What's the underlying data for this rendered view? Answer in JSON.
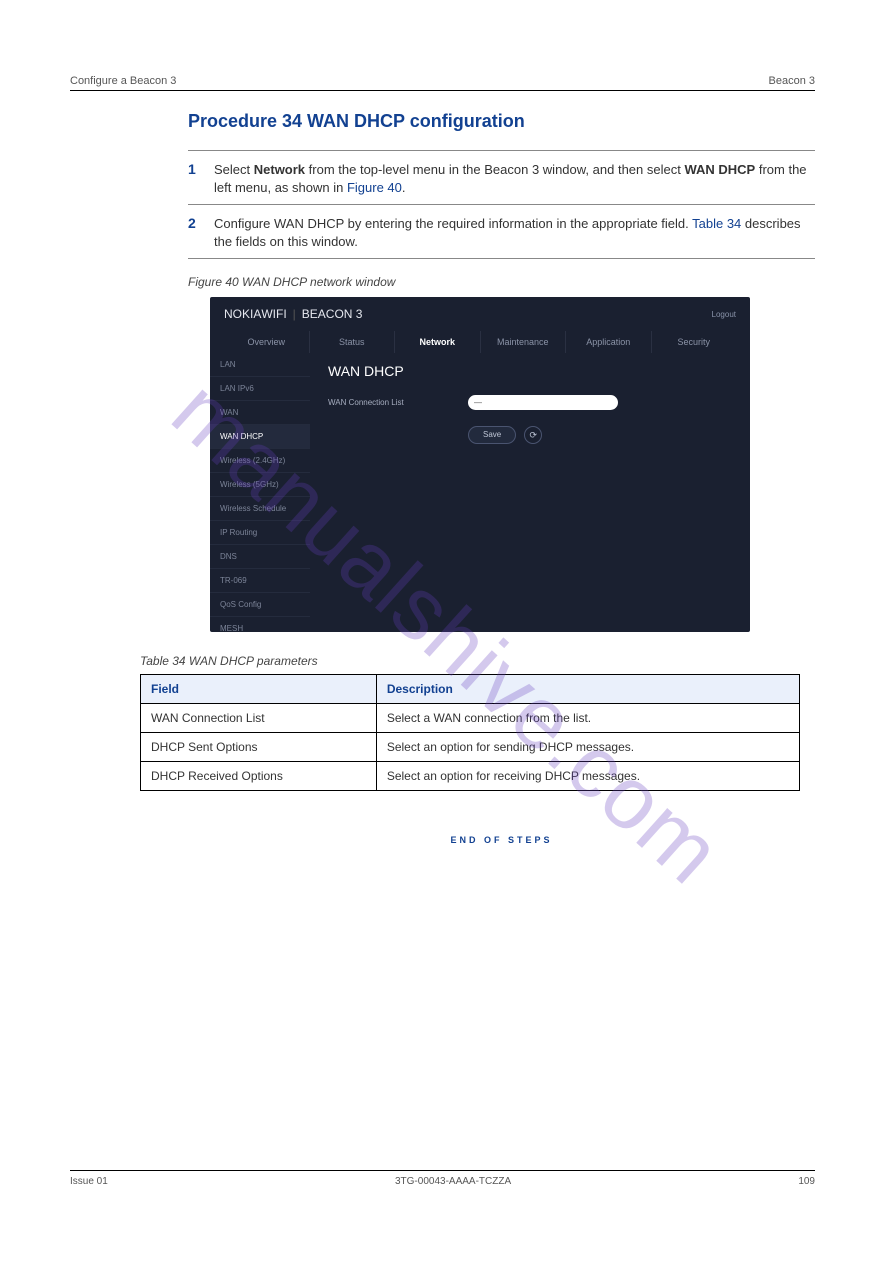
{
  "header": {
    "left": "Configure a Beacon 3",
    "right": "Beacon 3"
  },
  "procedure": {
    "title": "Procedure 34  WAN DHCP configuration",
    "step1": {
      "num": "1",
      "text_a": "Select ",
      "bold1": "Network",
      "text_b": " from the top-level menu in the Beacon 3 window, and then select ",
      "bold2": "WAN DHCP",
      "text_c": " from the left menu, as shown in ",
      "figlink": "Figure 40",
      "text_d": "."
    },
    "step2": {
      "num": "2",
      "text_a": "Configure WAN DHCP by entering the required information in the appropriate field. ",
      "tbllink": "Table 34",
      "text_b": " describes the fields on this window."
    }
  },
  "figure": {
    "caption": "Figure 40  WAN DHCP network window"
  },
  "screenshot": {
    "brand": "NOKIA",
    "brand_suffix": "WIFI",
    "product": "BEACON 3",
    "logout": "Logout",
    "nav": [
      "Overview",
      "Status",
      "Network",
      "Maintenance",
      "Application",
      "Security"
    ],
    "nav_active": 2,
    "sidebar": [
      "LAN",
      "LAN IPv6",
      "WAN",
      "WAN DHCP",
      "Wireless (2.4GHz)",
      "Wireless (5GHz)",
      "Wireless Schedule",
      "IP Routing",
      "DNS",
      "TR-069",
      "QoS Config",
      "MESH"
    ],
    "sidebar_active": 3,
    "main_title": "WAN DHCP",
    "field_label": "WAN Connection List",
    "select_value": "—",
    "save_btn": "Save",
    "refresh_icon": "⟳"
  },
  "table": {
    "caption": "Table 34  WAN DHCP parameters",
    "headers": [
      "Field",
      "Description"
    ],
    "rows": [
      [
        "WAN Connection List",
        "Select a WAN connection from the list."
      ],
      [
        "DHCP Sent Options",
        "Select an option for sending DHCP messages."
      ],
      [
        "DHCP Received Options",
        "Select an option for receiving DHCP messages."
      ]
    ]
  },
  "end_marker": "END OF STEPS",
  "footer": {
    "left": "Issue 01",
    "center": "3TG-00043-AAAA-TCZZA",
    "right": "109"
  },
  "watermark": "manualshive.com"
}
